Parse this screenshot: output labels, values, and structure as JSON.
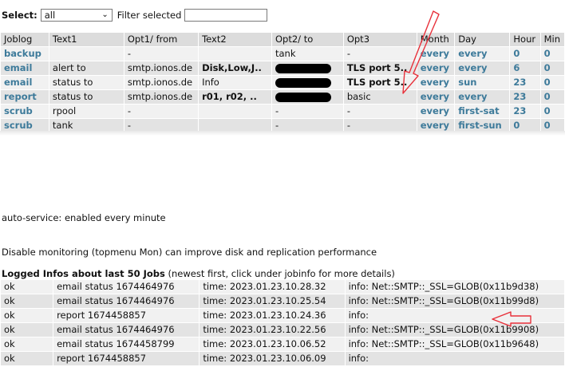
{
  "filterbar": {
    "select_label": "Select:",
    "select_value": "all",
    "filter_label": "Filter selected",
    "filter_value": ""
  },
  "jobs": {
    "headers": [
      "Joblog",
      "Text1",
      "Opt1/ from",
      "Text2",
      "Opt2/ to",
      "Opt3",
      "Month",
      "Day",
      "Hour",
      "Min"
    ],
    "rows": [
      [
        "backup",
        "",
        "-",
        "",
        "tank",
        "-",
        "every",
        "every",
        "0",
        "0"
      ],
      [
        "email",
        "alert to",
        "smtp.ionos.de",
        "Disk,Low,J..",
        "",
        "TLS port 5..",
        "every",
        "every",
        "6",
        "0"
      ],
      [
        "email",
        "status to",
        "smtp.ionos.de",
        "Info",
        "",
        "TLS port 5..",
        "every",
        "sun",
        "23",
        "0"
      ],
      [
        "report",
        "status to",
        "smtp.ionos.de",
        "r01, r02, ..",
        "",
        "basic",
        "every",
        "every",
        "23",
        "0"
      ],
      [
        "scrub",
        "rpool",
        "-",
        "",
        "-",
        "-",
        "every",
        "first-sat",
        "23",
        "0"
      ],
      [
        "scrub",
        "tank",
        "-",
        "",
        "-",
        "-",
        "every",
        "first-sun",
        "0",
        "0"
      ]
    ]
  },
  "notices": {
    "auto_service": "auto-service: enabled every minute",
    "monitoring": "Disable monitoring (topmenu Mon) can improve disk and replication performance"
  },
  "logs": {
    "title": "Logged Infos about last 50 Jobs",
    "subtitle": " (newest first, click under jobinfo for more details)",
    "rows": [
      [
        "ok",
        "email status 1674464976",
        "time: 2023.01.23.10.28.32",
        "info: Net::SMTP::_SSL=GLOB(0x11b9d38)"
      ],
      [
        "ok",
        "email status 1674464976",
        "time: 2023.01.23.10.25.54",
        "info: Net::SMTP::_SSL=GLOB(0x11b99d8)"
      ],
      [
        "ok",
        "report 1674458857",
        "time: 2023.01.23.10.24.36",
        "info:"
      ],
      [
        "ok",
        "email status 1674464976",
        "time: 2023.01.23.10.22.56",
        "info: Net::SMTP::_SSL=GLOB(0x11b9908)"
      ],
      [
        "ok",
        "email status 1674458799",
        "time: 2023.01.23.10.06.52",
        "info: Net::SMTP::_SSL=GLOB(0x11b9648)"
      ],
      [
        "ok",
        "report 1674458857",
        "time: 2023.01.23.10.06.09",
        "info:"
      ]
    ]
  },
  "colors": {
    "link": "#3d7a9a",
    "annotation": "#e8303a"
  }
}
